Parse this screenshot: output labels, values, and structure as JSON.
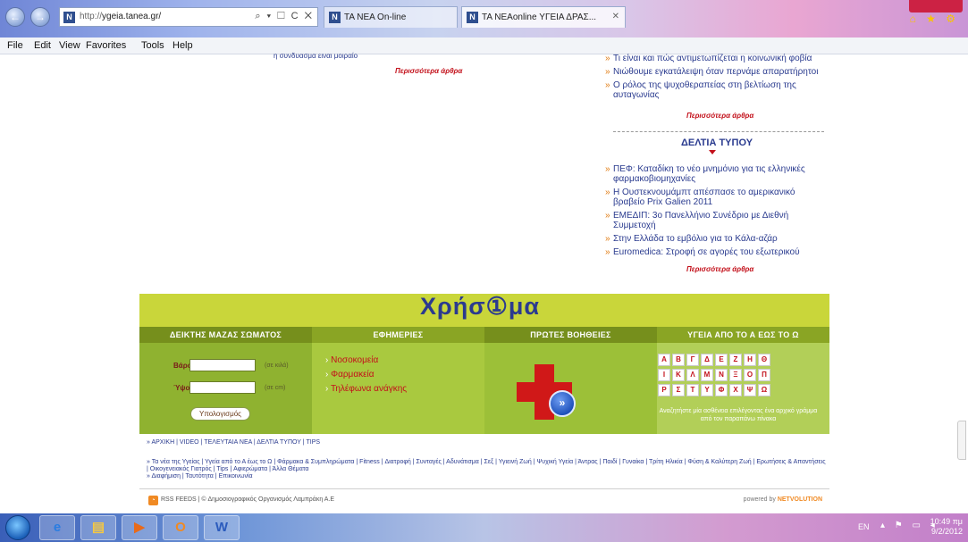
{
  "browser": {
    "url_prefix": "http://",
    "url_domain": "ygeia.tanea.gr/",
    "addr_tools": "⌕ ▾ ☐ C ✕",
    "tabs": [
      {
        "label": "TA NEA On-line",
        "close": ""
      },
      {
        "label": "TA NEAonline ΥΓΕΙΑ ΔΡΑΣ...",
        "close": "✕"
      }
    ],
    "favicon_letter": "N",
    "back": "←",
    "forward": "→",
    "right_icons": "⌂ ★ ⚙"
  },
  "menu": [
    "File",
    "Edit",
    "View",
    "Favorites",
    "Tools",
    "Help"
  ],
  "top_snippet": "η συνδυασμα ειναι μοιραίο",
  "left_more": "Περισσότερα άρθρα",
  "articles": [
    "Τι είναι και πώς αντιμετωπίζεται η κοινωνική φοβία",
    "Νιώθουμε εγκατάλειψη όταν περνάμε απαρατήρητοι",
    "Ο ρόλος της ψυχοθεραπείας στη βελτίωση της αυταγωνίας"
  ],
  "articles_more": "Περισσότερα άρθρα",
  "press": {
    "title": "ΔΕΛΤΙΑ ΤΥΠΟΥ",
    "items": [
      "ΠΕΦ: Καταδίκη το νέο μνημόνιο για τις ελληνικές φαρμακοβιομηχανίες",
      "Η Ουστεκνουμάμπτ απέσπασε το αμερικανικό βραβείο Prix Galien 2011",
      "ΕΜΕΔΙΠ: 3ο Πανελλήνιο Συνέδριο με Διεθνή Συμμετοχή",
      "Στην Ελλάδα το εμβόλιο για το Κάλα-αζάρ",
      "Euromedica: Στροφή σε αγορές του εξωτερικού"
    ],
    "more": "Περισσότερα άρθρα"
  },
  "chrisima": {
    "logo": "Χρήσ①μα",
    "columns": [
      "ΔΕΙΚΤΗΣ ΜΑΖΑΣ ΣΩΜΑΤΟΣ",
      "ΕΦΗΜΕΡΙΕΣ",
      "ΠΡΩΤΕΣ ΒΟΗΘΕΙΕΣ",
      "ΥΓΕΙΑ ΑΠΟ ΤΟ Α ΕΩΣ ΤΟ Ω"
    ],
    "bmi": {
      "weight_label": "Βάρος",
      "weight_unit": "(σε κιλά)",
      "height_label": "Ύψος",
      "height_unit": "(σε cm)",
      "button": "Υπολογισμός"
    },
    "ephemeries": [
      "Νοσοκομεία",
      "Φαρμακεία",
      "Τηλέφωνα ανάγκης"
    ],
    "go_arrow": "»",
    "alphabet": [
      [
        "Α",
        "Β",
        "Γ",
        "Δ",
        "Ε",
        "Ζ",
        "Η",
        "Θ"
      ],
      [
        "Ι",
        "Κ",
        "Λ",
        "Μ",
        "Ν",
        "Ξ",
        "Ο",
        "Π"
      ],
      [
        "Ρ",
        "Σ",
        "Τ",
        "Υ",
        "Φ",
        "Χ",
        "Ψ",
        "Ω"
      ]
    ],
    "alphabet_note": "Αναζητήστε μία ασθένεια επιλέγοντας ένα αρχικό γράμμα από τον παραπάνω πίνακα"
  },
  "footer": {
    "nav": "»  ΑΡΧΙΚΗ | VIDEO | ΤΕΛΕΥΤΑΙΑ ΝΕΑ | ΔΕΛΤΙΑ ΤΥΠΟΥ | TIPS",
    "cats": "»  Τα νέα της Υγείας | Υγεία από το Α έως το Ω | Φάρμακα & Συμπληρώματα | Fitness | Διατροφή | Συνταγές | Αδυνάτισμα | Σεξ | Υγιεινή Ζωή | Ψυχική Υγεία | Άντρας | Παιδί | Γυναίκα | Τρίτη Ηλικία | Φύση & Καλύτερη Ζωή | Ερωτήσεις & Απαντήσεις | Οικογενειακός Γιατρός | Tips | Αφιερώματα | Άλλα Θέματα",
    "cats2": "»  Διαφήμιση | Ταυτότητα | Επικοινωνία",
    "rss_icon": "◔",
    "rss": "RSS FEEDS | © Δημοσιογραφικός Οργανισμός Λαμπράκη Α.Ε",
    "powered_prefix": "powered by",
    "powered_brand": "NETVOLUTION"
  },
  "taskbar": {
    "apps": [
      "e",
      "▤",
      "▶",
      "O",
      "W"
    ],
    "lang": "EN",
    "tray": "▴ ⚑ ▭ ◂",
    "time": "10:49 πμ",
    "date": "9/2/2012"
  }
}
